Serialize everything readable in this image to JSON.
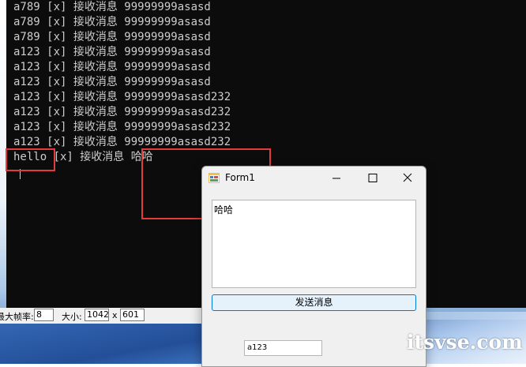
{
  "console": {
    "lines": [
      "a789 [x] 接收消息 99999999asasd",
      "a789 [x] 接收消息 99999999asasd",
      "a789 [x] 接收消息 99999999asasd",
      "a123 [x] 接收消息 99999999asasd",
      "a123 [x] 接收消息 99999999asasd",
      "a123 [x] 接收消息 99999999asasd",
      "a123 [x] 接收消息 99999999asasd232",
      "a123 [x] 接收消息 99999999asasd232",
      "a123 [x] 接收消息 99999999asasd232",
      "a123 [x] 接收消息 99999999asasd232",
      "hello [x] 接收消息 哈哈"
    ]
  },
  "toolbar": {
    "fps_label": "最大帧率:",
    "fps_value": "8",
    "size_label": "大小:",
    "width_value": "1042",
    "times": "x",
    "height_value": "601"
  },
  "form": {
    "title": "Form1",
    "message_text": "哈哈",
    "send_label": "发送消息",
    "user_value": "a123"
  },
  "watermark": "itsvse.com",
  "colors": {
    "highlight": "#e23b3b",
    "button_border": "#0078d7"
  }
}
